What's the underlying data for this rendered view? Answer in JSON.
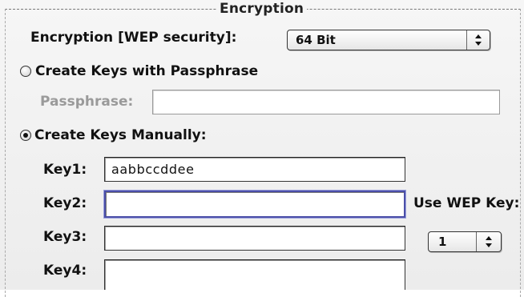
{
  "group": {
    "title": "Encryption"
  },
  "encryption": {
    "label": "Encryption [WEP security]:",
    "selected": "64 Bit"
  },
  "passphrase_option": {
    "label": "Create Keys with Passphrase",
    "checked": false
  },
  "passphrase": {
    "label": "Passphrase:",
    "value": ""
  },
  "manual_option": {
    "label": "Create Keys Manually:",
    "checked": true
  },
  "keys": [
    {
      "label": "Key1:",
      "value": "aabbccddee"
    },
    {
      "label": "Key2:",
      "value": ""
    },
    {
      "label": "Key3:",
      "value": ""
    },
    {
      "label": "Key4:",
      "value": ""
    }
  ],
  "use_wep_key": {
    "label": "Use WEP Key:",
    "selected": "1"
  },
  "colors": {
    "focus_ring": "#4b4fa8",
    "disabled_text": "#9a9a9a"
  },
  "icons": {
    "popup_arrows": "up-down-arrows-icon"
  }
}
